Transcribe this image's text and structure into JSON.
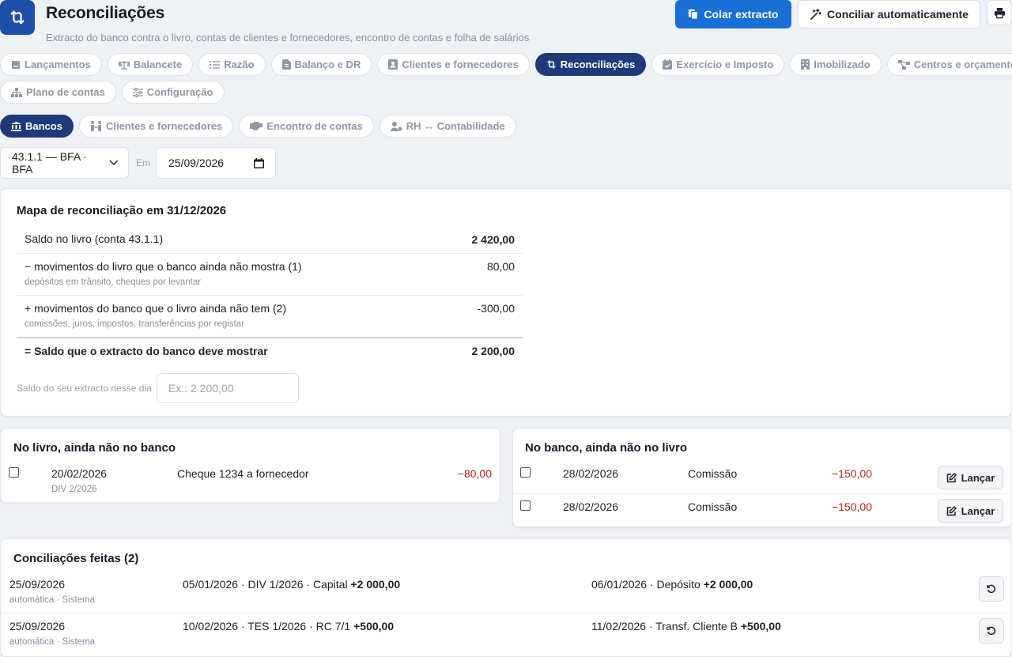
{
  "header": {
    "title": "Reconciliações",
    "subtitle": "Extracto do banco contra o livro, contas de clientes e fornecedores, encontro de contas e folha de salários",
    "paste_button": "Colar extracto",
    "auto_button": "Conciliar automaticamente"
  },
  "main_tabs": [
    {
      "label": "Lançamentos",
      "icon": "ledger-icon"
    },
    {
      "label": "Balancete",
      "icon": "scale-icon"
    },
    {
      "label": "Razão",
      "icon": "list-icon"
    },
    {
      "label": "Balanço e DR",
      "icon": "document-icon"
    },
    {
      "label": "Clientes e fornecedores",
      "icon": "contact-icon"
    },
    {
      "label": "Reconciliações",
      "icon": "reconcile-icon",
      "active": true
    },
    {
      "label": "Exercício e Imposto",
      "icon": "calendar-check-icon"
    },
    {
      "label": "Imobilizado",
      "icon": "building-icon"
    },
    {
      "label": "Centros e orçamento",
      "icon": "network-icon"
    },
    {
      "label": "Plano de contas",
      "icon": "hierarchy-icon"
    },
    {
      "label": "Configuração",
      "icon": "sliders-icon"
    }
  ],
  "sub_tabs": [
    {
      "label": "Bancos",
      "icon": "bank-icon",
      "active": true
    },
    {
      "label": "Clientes e fornecedores",
      "icon": "people-icon"
    },
    {
      "label": "Encontro de contas",
      "icon": "handshake-icon"
    },
    {
      "label": "RH ↔ Contabilidade",
      "icon": "user-gear-icon"
    }
  ],
  "filters": {
    "account": "43.1.1 — BFA · BFA",
    "em_label": "Em",
    "date": "25/09/2026"
  },
  "reconciliation_map": {
    "title": "Mapa de reconciliação em 31/12/2026",
    "rows": [
      {
        "label": "Saldo no livro (conta 43.1.1)",
        "sub": "",
        "value": "2 420,00"
      },
      {
        "label": "− movimentos do livro que o banco ainda não mostra (1)",
        "sub": "depósitos em trânsito, cheques por levantar",
        "value": "80,00"
      },
      {
        "label": "+ movimentos do banco que o livro ainda não tem (2)",
        "sub": "comissões, juros, impostos, transferências por registar",
        "value": "-300,00"
      },
      {
        "label": "= Saldo que o extracto do banco deve mostrar",
        "sub": "",
        "value": "2 200,00"
      }
    ],
    "saldo_label": "Saldo do seu extracto nesse dia",
    "saldo_placeholder": "Ex.: 2 200,00"
  },
  "book_not_bank": {
    "title": "No livro, ainda não no banco",
    "rows": [
      {
        "date": "20/02/2026",
        "doc": "DIV 2/2026",
        "description": "Cheque 1234 a fornecedor",
        "amount": "−80,00"
      }
    ]
  },
  "bank_not_book": {
    "title": "No banco, ainda não no livro",
    "rows": [
      {
        "date": "28/02/2026",
        "description": "Comissão",
        "amount": "−150,00",
        "action": "Lançar"
      },
      {
        "date": "28/02/2026",
        "description": "Comissão",
        "amount": "−150,00",
        "action": "Lançar"
      }
    ]
  },
  "done": {
    "title": "Conciliações feitas (2)",
    "rows": [
      {
        "date": "25/09/2026",
        "meta": "automática · Sistema",
        "book": "05/01/2026 · DIV 1/2026 · Capital ",
        "book_amount": "+2 000,00",
        "bank": "06/01/2026 · Depósito ",
        "bank_amount": "+2 000,00"
      },
      {
        "date": "25/09/2026",
        "meta": "automática · Sistema",
        "book": "10/02/2026 · TES 1/2026 · RC 7/1 ",
        "book_amount": "+500,00",
        "bank": "11/02/2026 · Transf. Cliente B ",
        "bank_amount": "+500,00"
      }
    ]
  },
  "colors": {
    "primary": "#1a6fd6",
    "active_tab": "#1e3a7b",
    "negative": "#b3261e"
  }
}
